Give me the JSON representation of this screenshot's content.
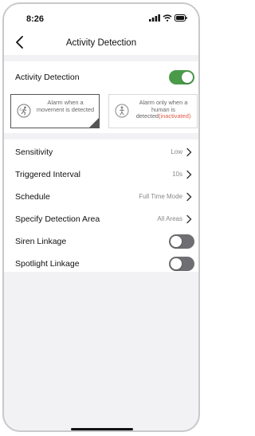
{
  "status_bar": {
    "time": "8:26"
  },
  "nav": {
    "title": "Activity Detection",
    "back_icon": "chevron-left-icon"
  },
  "activity_detection": {
    "label": "Activity Detection",
    "enabled": true,
    "modes": [
      {
        "text": "Alarm when a movement is detected",
        "icon": "motion-icon",
        "selected": true
      },
      {
        "text": "Alarm only when a human is detected",
        "status": "(inactivated)",
        "icon": "human-icon",
        "selected": false
      }
    ]
  },
  "settings": [
    {
      "label": "Sensitivity",
      "value": "Low"
    },
    {
      "label": "Triggered Interval",
      "value": "10s"
    },
    {
      "label": "Schedule",
      "value": "Full Time Mode"
    },
    {
      "label": "Specify Detection Area",
      "value": "All Areas"
    }
  ],
  "toggles": [
    {
      "label": "Siren Linkage",
      "enabled": false
    },
    {
      "label": "Spotlight Linkage",
      "enabled": false
    }
  ],
  "colors": {
    "toggle_on": "#4a9a4a",
    "toggle_off": "#6e6e73",
    "inactive_text": "#e05a4a"
  }
}
